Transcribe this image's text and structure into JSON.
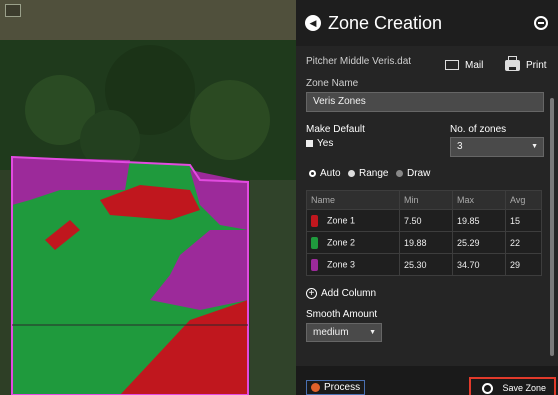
{
  "header": {
    "title": "Zone Creation"
  },
  "file_name": "Pitcher Middle Veris.dat",
  "actions": {
    "mail_label": "Mail",
    "print_label": "Print"
  },
  "zone_name": {
    "label": "Zone Name",
    "value": "Veris Zones"
  },
  "make_default": {
    "label": "Make Default",
    "option": "Yes",
    "checked": true
  },
  "num_zones": {
    "label": "No. of zones",
    "value": "3"
  },
  "mode": {
    "options": [
      "Auto",
      "Range",
      "Draw"
    ],
    "selected": "Auto"
  },
  "table": {
    "columns": [
      "Name",
      "Min",
      "Max",
      "Avg"
    ],
    "rows": [
      {
        "name": "Zone 1",
        "min": "7.50",
        "max": "19.85",
        "avg": "15",
        "color": "#c0171e"
      },
      {
        "name": "Zone 2",
        "min": "19.88",
        "max": "25.29",
        "avg": "22",
        "color": "#1f9a3d"
      },
      {
        "name": "Zone 3",
        "min": "25.30",
        "max": "34.70",
        "avg": "29",
        "color": "#9c2a9a"
      }
    ]
  },
  "add_column": "Add Column",
  "smooth": {
    "label": "Smooth Amount",
    "value": "medium"
  },
  "process_label": "Process",
  "save_label": "Save Zone",
  "colors": {
    "zone1": "#c0171e",
    "zone2": "#1f9a3d",
    "zone3": "#9c2a9a",
    "field_border": "#e24be0",
    "save_border": "#e23a2b"
  }
}
